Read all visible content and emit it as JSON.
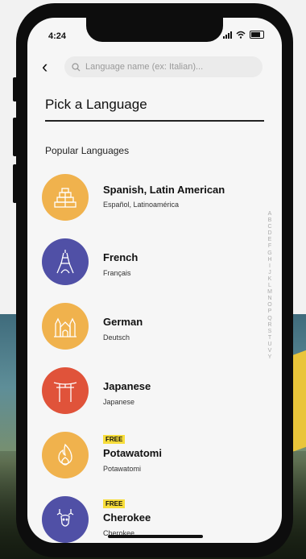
{
  "status": {
    "time": "4:24"
  },
  "search": {
    "placeholder": "Language name (ex: Italian)..."
  },
  "page": {
    "title": "Pick a Language",
    "section": "Popular Languages"
  },
  "languages": [
    {
      "name": "Spanish, Latin American",
      "native": "Español, Latinoamérica",
      "free": "",
      "icon": "pyramid-icon",
      "color": "#f0b24d"
    },
    {
      "name": "French",
      "native": "Français",
      "free": "",
      "icon": "eiffel-tower-icon",
      "color": "#5050a6"
    },
    {
      "name": "German",
      "native": "Deutsch",
      "free": "",
      "icon": "castle-icon",
      "color": "#f0b24d"
    },
    {
      "name": "Japanese",
      "native": "Japanese",
      "free": "",
      "icon": "torii-gate-icon",
      "color": "#e0533a"
    },
    {
      "name": "Potawatomi",
      "native": "Potawatomi",
      "free": "FREE",
      "icon": "fire-icon",
      "color": "#f0b24d"
    },
    {
      "name": "Cherokee",
      "native": "Cherokee",
      "free": "FREE",
      "icon": "deer-icon",
      "color": "#5050a6"
    }
  ],
  "alphabet": [
    "A",
    "B",
    "C",
    "D",
    "E",
    "F",
    "G",
    "H",
    "I",
    "J",
    "K",
    "L",
    "M",
    "N",
    "O",
    "P",
    "Q",
    "R",
    "S",
    "T",
    "U",
    "V",
    "Y"
  ]
}
